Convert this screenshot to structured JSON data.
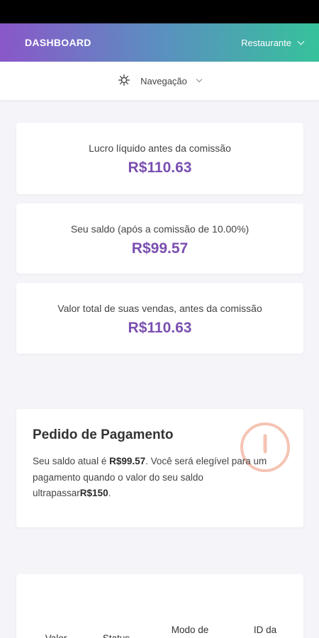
{
  "header": {
    "brand": "DASHBOARD",
    "restaurant_label": "Restaurante",
    "gradient": [
      "#8a57c9",
      "#36c29b"
    ]
  },
  "nav": {
    "icon": "compass-icon",
    "label": "Navegação"
  },
  "stats": [
    {
      "label": "Lucro líquido antes da comissão",
      "value": "R$110.63"
    },
    {
      "label": "Seu saldo (após a comissão de 10.00%)",
      "value": "R$99.57"
    },
    {
      "label": "Valor total de suas vendas, antes da comissão",
      "value": "R$110.63"
    }
  ],
  "payment": {
    "title": "Pedido de Pagamento",
    "text_1": "Seu saldo atual é ",
    "balance": "R$99.57",
    "text_2": ". Você será elegível para um pagamento quando o valor do seu saldo ultrapassar",
    "threshold": "R$150",
    "text_3": ".",
    "icon": "alert-circle-icon",
    "icon_color": "#f5c4b4"
  },
  "table": {
    "headers": [
      "Valor",
      "Status",
      "Modo de",
      "ID da"
    ]
  },
  "colors": {
    "accent": "#7a4fb0",
    "background": "#f4f4f9"
  }
}
